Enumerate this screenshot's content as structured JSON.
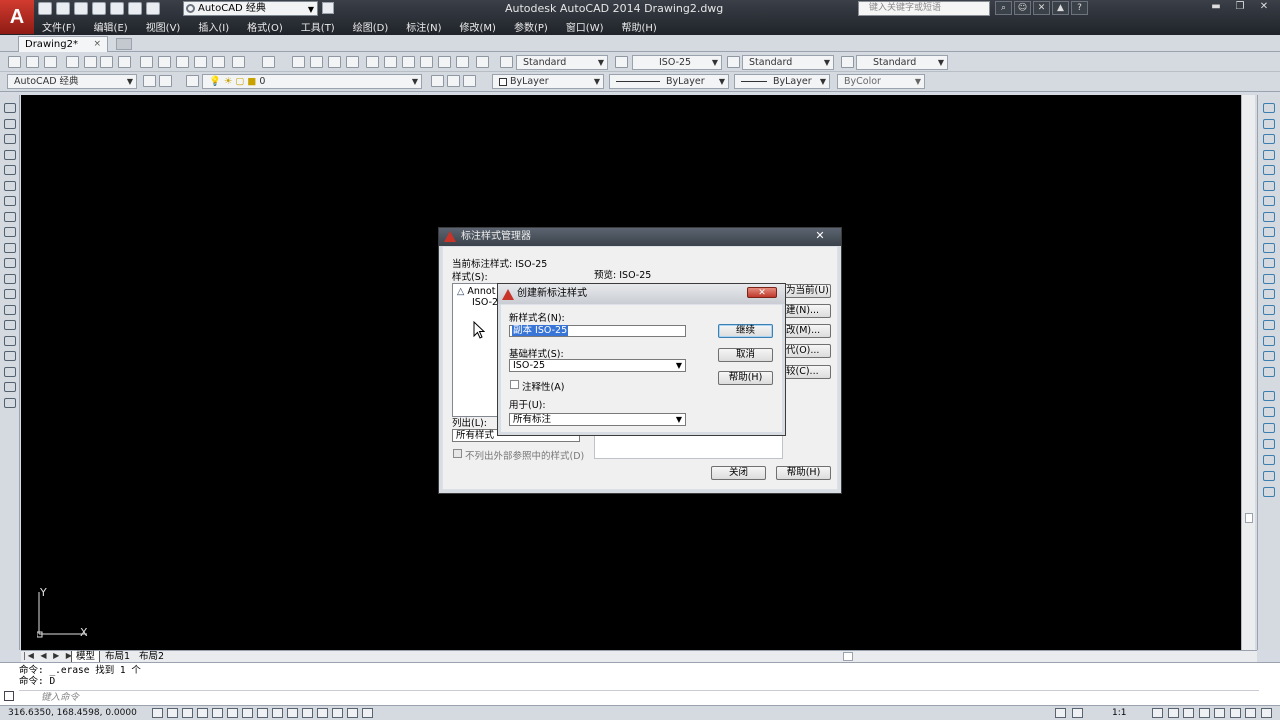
{
  "app": {
    "logo_letter": "A",
    "window_title": "Autodesk AutoCAD 2014    Drawing2.dwg",
    "workspace": "AutoCAD 经典",
    "search_placeholder": "键入关键字或短语"
  },
  "menu": [
    "文件(F)",
    "编辑(E)",
    "视图(V)",
    "插入(I)",
    "格式(O)",
    "工具(T)",
    "绘图(D)",
    "标注(N)",
    "修改(M)",
    "参数(P)",
    "窗口(W)",
    "帮助(H)"
  ],
  "document_tab": {
    "label": "Drawing2*",
    "close": "×"
  },
  "toolbar": {
    "text_style": "Standard",
    "dim_style": "ISO-25",
    "table_style": "Standard",
    "mleader_style": "Standard",
    "workspace2": "AutoCAD 经典",
    "layer": "0",
    "color": "ByLayer",
    "linetype": "ByLayer",
    "lineweight": "ByLayer",
    "plotstyle": "ByColor"
  },
  "ucs": {
    "x": "X",
    "y": "Y"
  },
  "layout_tabs": [
    "模型",
    "布局1",
    "布局2"
  ],
  "command": {
    "history": [
      "命令: _.erase 找到 1 个",
      "命令: D"
    ],
    "prompt": "键入命令"
  },
  "status": {
    "coords": "316.6350, 168.4598, 0.0000",
    "scale": "1:1"
  },
  "dim_style_manager": {
    "title": "标注样式管理器",
    "current_style_label": "当前标注样式:",
    "current_style": "ISO-25",
    "styles_label": "样式(S):",
    "preview_label": "预览:",
    "preview_style": "ISO-25",
    "styles": [
      "Annot",
      "ISO-2"
    ],
    "list_label": "列出(L):",
    "list_value": "所有样式",
    "exclude_xref": "不列出外部参照中的样式(D)",
    "side_buttons": [
      "为当前(U)",
      "建(N)...",
      "改(M)...",
      "代(O)...",
      "较(C)..."
    ],
    "close": "关闭",
    "help": "帮助(H)"
  },
  "create_new_dim_style": {
    "title": "创建新标注样式",
    "new_name_label": "新样式名(N):",
    "new_name_value": "副本 ISO-25",
    "start_with_label": "基础样式(S):",
    "start_with_value": "ISO-25",
    "annotative": "注释性(A)",
    "use_for_label": "用于(U):",
    "use_for_value": "所有标注",
    "continue": "继续",
    "cancel": "取消",
    "help": "帮助(H)"
  }
}
